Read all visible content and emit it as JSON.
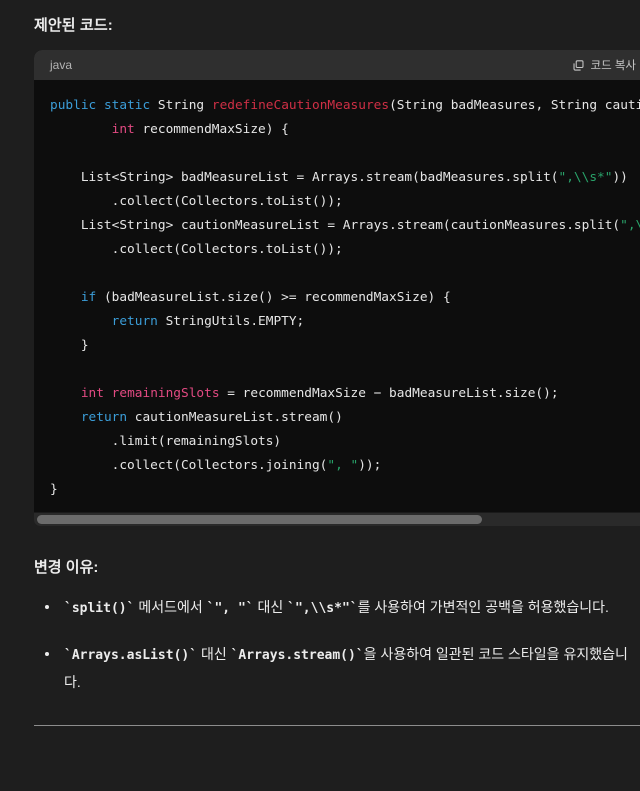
{
  "page": {
    "background": "#1e1e1e",
    "text_color": "#ececec"
  },
  "suggested_code": {
    "heading": "제안된 코드:",
    "language_label": "java",
    "copy_button_label": "코드 복사",
    "copy_icon": "copy-icon",
    "scrollbar": {
      "orientation": "horizontal",
      "thumb_width_percent": 73
    },
    "code_lines": [
      [
        {
          "t": "public",
          "c": "kw"
        },
        {
          "t": " ",
          "c": "plain"
        },
        {
          "t": "static",
          "c": "kw"
        },
        {
          "t": " ",
          "c": "plain"
        },
        {
          "t": "String",
          "c": "type"
        },
        {
          "t": " ",
          "c": "plain"
        },
        {
          "t": "redefineCautionMeasures",
          "c": "fn"
        },
        {
          "t": "(String badMeasures, String cautionMeasures,",
          "c": "plain"
        }
      ],
      [
        {
          "t": "        ",
          "c": "plain"
        },
        {
          "t": "int",
          "c": "pink"
        },
        {
          "t": " recommendMaxSize) {",
          "c": "plain"
        }
      ],
      [],
      [
        {
          "t": "    List<String> badMeasureList = Arrays.stream(badMeasures.split(",
          "c": "plain"
        },
        {
          "t": "\",\\\\s*\"",
          "c": "string"
        },
        {
          "t": "))",
          "c": "plain"
        }
      ],
      [
        {
          "t": "        .collect(Collectors.toList());",
          "c": "plain"
        }
      ],
      [
        {
          "t": "    List<String> cautionMeasureList = Arrays.stream(cautionMeasures.split(",
          "c": "plain"
        },
        {
          "t": "\",\\\\s*\"",
          "c": "string"
        },
        {
          "t": "))",
          "c": "plain"
        }
      ],
      [
        {
          "t": "        .collect(Collectors.toList());",
          "c": "plain"
        }
      ],
      [],
      [
        {
          "t": "    ",
          "c": "plain"
        },
        {
          "t": "if",
          "c": "kw"
        },
        {
          "t": " (badMeasureList.size() >= recommendMaxSize) {",
          "c": "plain"
        }
      ],
      [
        {
          "t": "        ",
          "c": "plain"
        },
        {
          "t": "return",
          "c": "kw"
        },
        {
          "t": " StringUtils.EMPTY;",
          "c": "plain"
        }
      ],
      [
        {
          "t": "    }",
          "c": "plain"
        }
      ],
      [],
      [
        {
          "t": "    ",
          "c": "plain"
        },
        {
          "t": "int",
          "c": "pink"
        },
        {
          "t": " ",
          "c": "plain"
        },
        {
          "t": "remainingSlots",
          "c": "pink"
        },
        {
          "t": " = recommendMaxSize − badMeasureList.size();",
          "c": "plain"
        }
      ],
      [
        {
          "t": "    ",
          "c": "plain"
        },
        {
          "t": "return",
          "c": "kw"
        },
        {
          "t": " cautionMeasureList.stream()",
          "c": "plain"
        }
      ],
      [
        {
          "t": "        .limit(remainingSlots)",
          "c": "plain"
        }
      ],
      [
        {
          "t": "        .collect(Collectors.joining(",
          "c": "plain"
        },
        {
          "t": "\", \"",
          "c": "string"
        },
        {
          "t": "));",
          "c": "plain"
        }
      ],
      [
        {
          "t": "}",
          "c": "plain"
        }
      ]
    ]
  },
  "reasons": {
    "heading": "변경 이유:",
    "items": [
      [
        {
          "t": "`split()`",
          "m": true
        },
        {
          "t": " 메서드에서 ",
          "m": false
        },
        {
          "t": "`\", \"`",
          "m": true
        },
        {
          "t": " 대신 ",
          "m": false
        },
        {
          "t": "`\",\\\\s*\"`",
          "m": true
        },
        {
          "t": "를 사용하여 가변적인 공백을 허용했습니다.",
          "m": false
        }
      ],
      [
        {
          "t": "`Arrays.asList()`",
          "m": true
        },
        {
          "t": " 대신 ",
          "m": false
        },
        {
          "t": "`Arrays.stream()`",
          "m": true
        },
        {
          "t": "을 사용하여 일관된 코드 스타일을 유지했습니다.",
          "m": false
        }
      ]
    ]
  },
  "colors": {
    "keyword": "#3b9dd8",
    "function_name": "#cf2f45",
    "pink_identifier": "#e24a82",
    "string": "#29a36a",
    "code_background": "#0d0d0d",
    "header_background": "#2f2f2f",
    "divider": "#8d8d8d"
  }
}
